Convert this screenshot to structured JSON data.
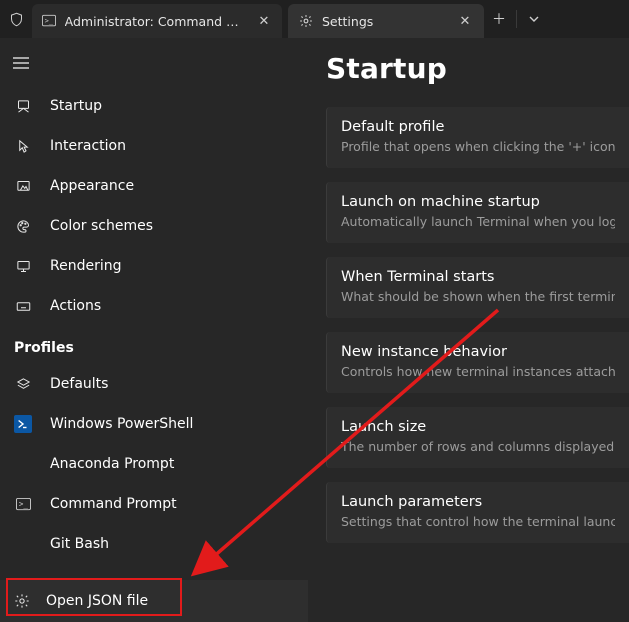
{
  "tabs": {
    "inactive": {
      "title": "Administrator: Command Prom"
    },
    "active": {
      "title": "Settings"
    }
  },
  "sidebar": {
    "items": [
      {
        "label": "Startup"
      },
      {
        "label": "Interaction"
      },
      {
        "label": "Appearance"
      },
      {
        "label": "Color schemes"
      },
      {
        "label": "Rendering"
      },
      {
        "label": "Actions"
      }
    ],
    "profiles_header": "Profiles",
    "profiles": [
      {
        "label": "Defaults"
      },
      {
        "label": "Windows PowerShell"
      },
      {
        "label": "Anaconda Prompt"
      },
      {
        "label": "Command Prompt"
      },
      {
        "label": "Git Bash"
      }
    ],
    "open_json": "Open JSON file"
  },
  "page": {
    "title": "Startup",
    "cards": [
      {
        "title": "Default profile",
        "sub": "Profile that opens when clicking the '+' icon or by typ"
      },
      {
        "title": "Launch on machine startup",
        "sub": "Automatically launch Terminal when you log in to Win"
      },
      {
        "title": "When Terminal starts",
        "sub": "What should be shown when the first terminal is crea"
      },
      {
        "title": "New instance behavior",
        "sub": "Controls how new terminal instances attach to existin"
      },
      {
        "title": "Launch size",
        "sub": "The number of rows and columns displayed in the win"
      },
      {
        "title": "Launch parameters",
        "sub": "Settings that control how the terminal launches"
      }
    ]
  }
}
